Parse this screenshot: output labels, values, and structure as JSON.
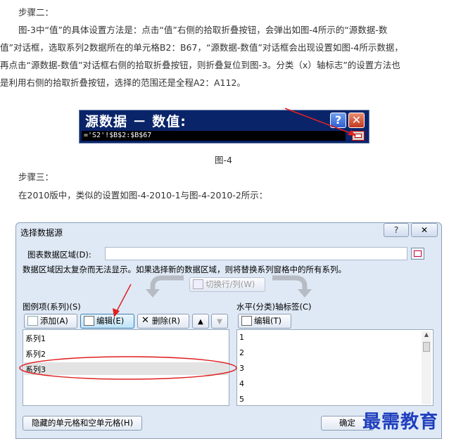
{
  "article": {
    "step2_heading": "步骤二：",
    "step2_lines": [
      "图-3中“值”的具体设置方法是：点击“值”右侧的拾取折叠按钮，会弹出如图-4所示的“源数据-数",
      "值”对话框，选取系列2数据所在的单元格B2：B67，“源数据-数值”对话框会出现设置如图-4所示数据，",
      "再点击“源数据-数值”对话框右侧的拾取折叠按钮，则折叠复位到图-3。分类（x）轴标志”的设置方法也",
      "是利用右侧的拾取折叠按钮，选择的范围还是全程A2：A112。"
    ],
    "fig4_caption": "图-4",
    "step3_heading": "步骤三：",
    "step3_text": "在2010版中，类似的设置如图-4-2010-1与图-4-2010-2所示："
  },
  "source_dialog": {
    "title": "源数据 － 数值:",
    "help_glyph": "?",
    "close_glyph": "✕",
    "reference": "='S2'!$B$2:$B$67"
  },
  "data_source_dialog": {
    "title": "选择数据源",
    "help_glyph": "?",
    "close_glyph": "✕",
    "range_label": "图表数据区域(D):",
    "range_value": "",
    "notice": "数据区域因太复杂而无法显示。如果选择新的数据区域，则将替换系列窗格中的所有系列。",
    "switch_label": "切换行/列(W)",
    "series_label": "图例项(系列)(S)",
    "add_label": "添加(A)",
    "edit_label": "编辑(E)",
    "delete_label": "删除(R)",
    "series": [
      "系列1",
      "系列2",
      "系列3"
    ],
    "selected_series": "系列3",
    "axis_label": "水平(分类)轴标签(C)",
    "axis_edit_label": "编辑(T)",
    "axis_items": [
      "1",
      "2",
      "3",
      "4",
      "5"
    ],
    "hidden_cells_label": "隐藏的单元格和空单元格(H)",
    "ok_label": "确定"
  },
  "watermark": "最需教育",
  "colors": {
    "annotation_red": "#e02020",
    "title_bar_blue": "#0a246a",
    "dialog_bg": "#dfe9f5"
  }
}
